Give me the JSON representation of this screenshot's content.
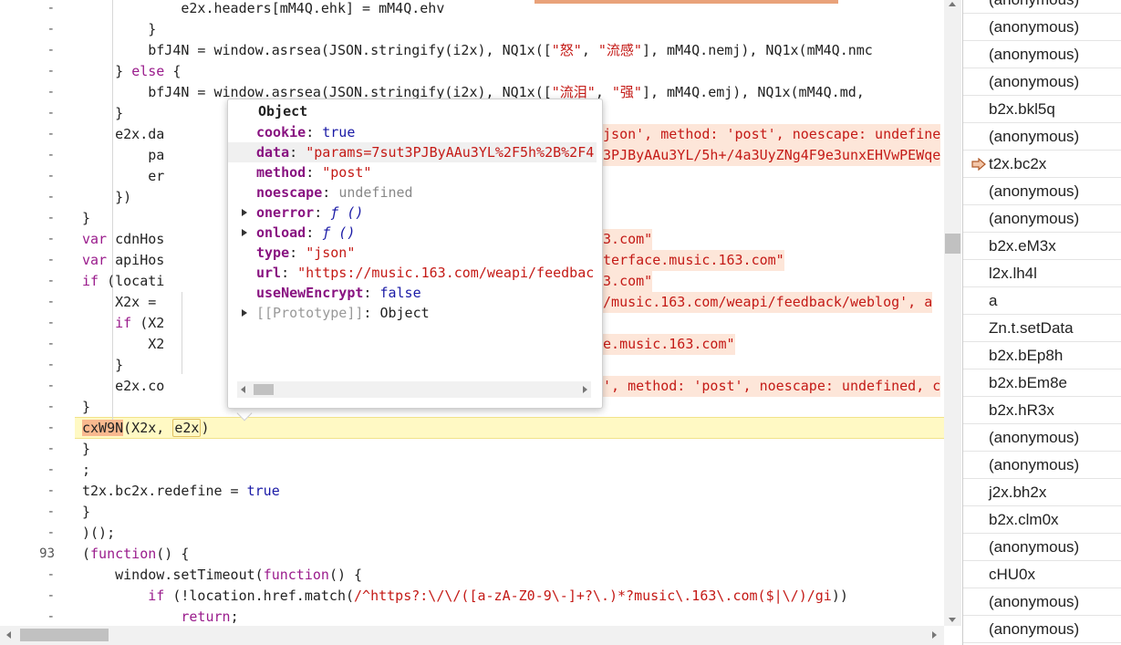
{
  "gutter": {
    "markers": [
      "-",
      "-",
      "-",
      "-",
      "-",
      "-",
      "-",
      "-",
      "-",
      "-",
      "-",
      "-",
      "-",
      "-",
      "-",
      "-",
      "-",
      "-",
      "-",
      "-",
      "-",
      "-",
      "-",
      "-",
      "-",
      "-",
      "93",
      "-",
      "-",
      "-"
    ]
  },
  "code": {
    "lines": [
      [
        "            e2x.headers[mM4Q.ehk] = mM4Q.ehv"
      ],
      [
        "        }"
      ],
      [
        "        bfJ4N = window.asrsea(JSON.stringify(i2x), NQ1x([",
        "\"怒\"",
        ", ",
        "\"流感\"",
        "], mM4Q.nemj), NQ1x(mM4Q.nmc"
      ],
      [
        "    } ",
        "else",
        " {"
      ],
      [
        "        bfJ4N = window.asrsea(JSON.stringify(i2x), NQ1x([",
        "\"流泪\"",
        ", ",
        "\"强\"",
        "], mM4Q.emj), NQ1x(mM4Q.md,"
      ],
      [
        "    }"
      ],
      [
        "    e2x.da",
        "'json', method: 'post', noescape: undefine"
      ],
      [
        "        pa",
        "t3PJByAAu3YL/5h+/4a3UyZNg4F9e3unxEHVwPEWqe"
      ],
      [
        "        er"
      ],
      [
        "    })"
      ],
      [
        "}"
      ],
      [
        "var",
        " cdnHos",
        "63.com\""
      ],
      [
        "var",
        " apiHos",
        "nterface.music.163.com\""
      ],
      [
        "if",
        " (locati",
        "63.com\""
      ],
      [
        "    X2x = ",
        "//music.163.com/weapi/feedback/weblog', a"
      ],
      [
        "    ",
        "if",
        " (X2"
      ],
      [
        "        X2",
        "ce.music.163.com\""
      ],
      [
        "    }"
      ],
      [
        "    e2x.co",
        "n', method: 'post', noescape: undefined, c"
      ],
      [
        "}"
      ],
      [
        "cxW9N",
        "(X2x, ",
        "e2x",
        ")"
      ],
      [
        "}"
      ],
      [
        ";"
      ],
      [
        "t2x.bc2x.redefine = ",
        "true"
      ],
      [
        "}"
      ],
      [
        ")();"
      ],
      [
        "(",
        "function",
        "() {"
      ],
      [
        "    window.setTimeout(",
        "function",
        "() {"
      ],
      [
        "        ",
        "if",
        " (!location.href.match(",
        "/^https?:\\/\\/([a-zA-Z0-9\\-]+?\\.)*?music\\.163\\.com($|\\/)/gi",
        "))"
      ],
      [
        "            ",
        "return",
        ";"
      ]
    ]
  },
  "popover": {
    "title": "Object",
    "props": [
      {
        "key": "cookie",
        "value": "true",
        "kind": "lit",
        "expandable": false
      },
      {
        "key": "data",
        "value": "\"params=7sut3PJByAAu3YL%2F5h%2B%2F4",
        "kind": "str",
        "expandable": false,
        "selected": true
      },
      {
        "key": "method",
        "value": "\"post\"",
        "kind": "str",
        "expandable": false
      },
      {
        "key": "noescape",
        "value": "undefined",
        "kind": "undef",
        "expandable": false
      },
      {
        "key": "onerror",
        "value": "ƒ ()",
        "kind": "fn",
        "expandable": true
      },
      {
        "key": "onload",
        "value": "ƒ ()",
        "kind": "fn",
        "expandable": true
      },
      {
        "key": "type",
        "value": "\"json\"",
        "kind": "str",
        "expandable": false
      },
      {
        "key": "url",
        "value": "\"https://music.163.com/weapi/feedbac",
        "kind": "str",
        "expandable": false
      },
      {
        "key": "useNewEncrypt",
        "value": "false",
        "kind": "lit",
        "expandable": false
      },
      {
        "key": "[[Prototype]]",
        "value": "Object",
        "kind": "plain",
        "expandable": true,
        "dim": true
      }
    ]
  },
  "callstack": {
    "frames": [
      "(anonymous)",
      "(anonymous)",
      "(anonymous)",
      "(anonymous)",
      "b2x.bkl5q",
      "(anonymous)",
      "t2x.bc2x",
      "(anonymous)",
      "(anonymous)",
      "b2x.eM3x",
      "l2x.lh4l",
      "a",
      "Zn.t.setData",
      "b2x.bEp8h",
      "b2x.bEm8e",
      "b2x.hR3x",
      "(anonymous)",
      "(anonymous)",
      "j2x.bh2x",
      "b2x.clm0x",
      "(anonymous)",
      "cHU0x",
      "(anonymous)",
      "(anonymous)"
    ],
    "current_index": 6
  },
  "colors": {
    "highlight_line": "#fff9c4",
    "keyword": "#9a1c8c",
    "string": "#c41a16",
    "literal": "#1a1aa6",
    "inline_value_bg": "#fde6d9"
  }
}
